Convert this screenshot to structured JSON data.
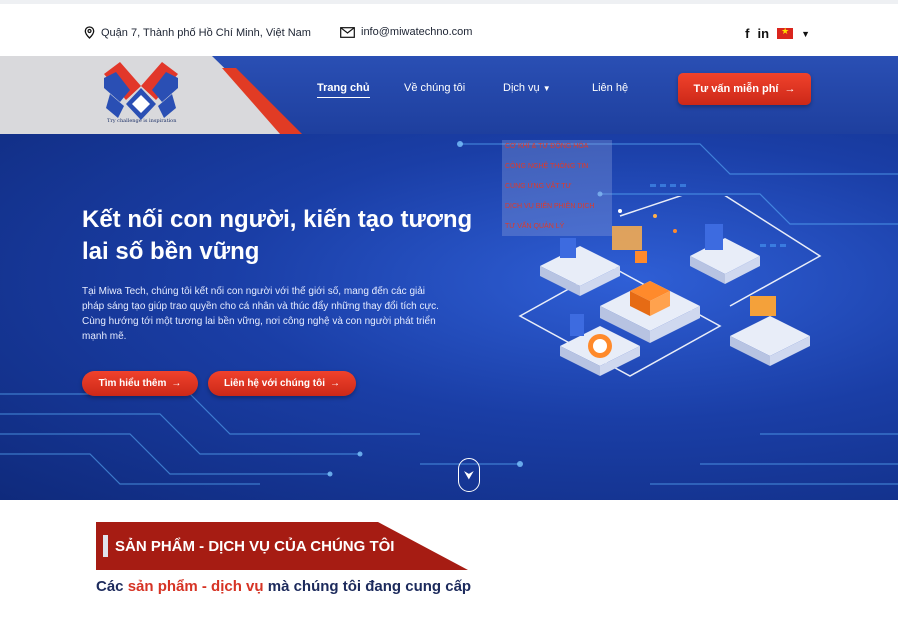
{
  "topbar": {
    "address": "Quận 7, Thành phố Hồ Chí Minh, Việt Nam",
    "email": "info@miwatechno.com",
    "social": [
      "facebook-icon",
      "linkedin-icon",
      "vietnam-flag"
    ]
  },
  "header": {
    "logo_tagline": "Try challenge is inspiration",
    "nav": [
      "Trang chủ",
      "Về chúng tôi",
      "Dịch vụ",
      "Liên hệ"
    ],
    "cta_label": "Tư vấn miễn phí",
    "services_menu": [
      "CƠ KHÍ & TỰ ĐỘNG HÓA",
      "CÔNG NGHỆ THÔNG TIN",
      "CUNG ỨNG VẬT TƯ",
      "DỊCH VỤ BIÊN PHIÊN DỊCH",
      "TƯ VẤN QUẢN LÝ"
    ]
  },
  "hero": {
    "title": "Kết nối con người, kiến tạo tương lai số bền vững",
    "description": "Tại Miwa Tech, chúng tôi kết nối con người với thế giới số, mang đến các giải pháp sáng tạo giúp trao quyền cho cá nhân và thúc đẩy những thay đổi tích cực. Cùng hướng tới một tương lai bền vững, nơi công nghệ và con người phát triển mạnh mẽ.",
    "btn_learn": "Tìm hiểu thêm",
    "btn_contact": "Liên hệ với chúng tôi"
  },
  "section": {
    "banner": "SẢN PHẨM - DỊCH VỤ CỦA CHÚNG TÔI",
    "subtitle_pre": "Các",
    "subtitle_hl": "sản phẩm - dịch vụ",
    "subtitle_post": "mà chúng tôi đang cung cấp"
  },
  "colors": {
    "primary_blue": "#1e3f9e",
    "accent_red": "#e13b24",
    "banner_red": "#a61c13",
    "text_dark": "#1c2a5c"
  }
}
